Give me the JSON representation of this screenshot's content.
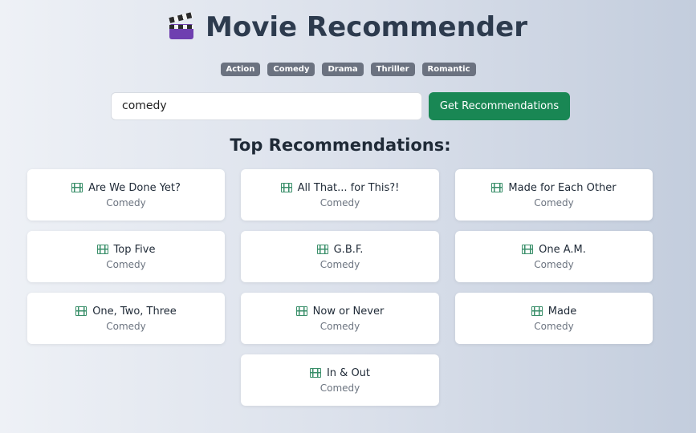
{
  "header": {
    "title": "Movie Recommender",
    "icon": "clapper-board-icon"
  },
  "genres": [
    "Action",
    "Comedy",
    "Drama",
    "Thriller",
    "Romantic"
  ],
  "search": {
    "value": "comedy",
    "button_label": "Get Recommendations"
  },
  "results": {
    "heading": "Top Recommendations:",
    "movies": [
      {
        "title": "Are We Done Yet?",
        "genre": "Comedy"
      },
      {
        "title": "All That... for This?!",
        "genre": "Comedy"
      },
      {
        "title": "Made for Each Other",
        "genre": "Comedy"
      },
      {
        "title": "Top Five",
        "genre": "Comedy"
      },
      {
        "title": "G.B.F.",
        "genre": "Comedy"
      },
      {
        "title": "One A.M.",
        "genre": "Comedy"
      },
      {
        "title": "One, Two, Three",
        "genre": "Comedy"
      },
      {
        "title": "Now or Never",
        "genre": "Comedy"
      },
      {
        "title": "Made",
        "genre": "Comedy"
      },
      {
        "title": "In & Out",
        "genre": "Comedy"
      }
    ]
  },
  "colors": {
    "accent": "#198754",
    "chip": "#6b7280",
    "title": "#2d3b4e"
  }
}
